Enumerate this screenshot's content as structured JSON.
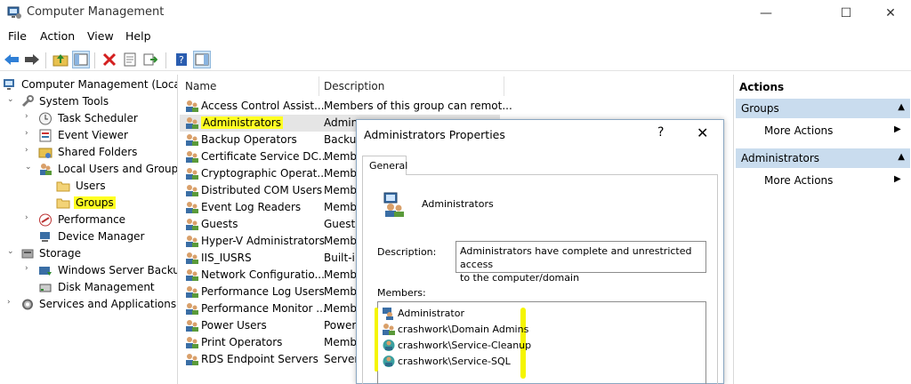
{
  "window": {
    "title": "Computer Management",
    "minimize": "—",
    "maximize": "☐",
    "close": "✕"
  },
  "menu": [
    "File",
    "Action",
    "View",
    "Help"
  ],
  "tree": {
    "root": "Computer Management (Local",
    "system_tools": "System Tools",
    "task_scheduler": "Task Scheduler",
    "event_viewer": "Event Viewer",
    "shared_folders": "Shared Folders",
    "local_users": "Local Users and Groups",
    "users": "Users",
    "groups": "Groups",
    "performance": "Performance",
    "device_manager": "Device Manager",
    "storage": "Storage",
    "wsb": "Windows Server Backup",
    "disk_mgmt": "Disk Management",
    "services": "Services and Applications"
  },
  "list": {
    "col_name": "Name",
    "col_desc": "Description",
    "rows": [
      {
        "name": "Access Control Assist...",
        "desc": "Members of this group can remot..."
      },
      {
        "name": "Administrators",
        "desc": "Admin"
      },
      {
        "name": "Backup Operators",
        "desc": "Backup"
      },
      {
        "name": "Certificate Service DC...",
        "desc": "Memb"
      },
      {
        "name": "Cryptographic Operat...",
        "desc": "Memb"
      },
      {
        "name": "Distributed COM Users",
        "desc": "Memb"
      },
      {
        "name": "Event Log Readers",
        "desc": "Memb"
      },
      {
        "name": "Guests",
        "desc": "Guests"
      },
      {
        "name": "Hyper-V Administrators",
        "desc": "Memb"
      },
      {
        "name": "IIS_IUSRS",
        "desc": "Built-i"
      },
      {
        "name": "Network Configuratio...",
        "desc": "Memb"
      },
      {
        "name": "Performance Log Users",
        "desc": "Memb"
      },
      {
        "name": "Performance Monitor ...",
        "desc": "Memb"
      },
      {
        "name": "Power Users",
        "desc": "Power"
      },
      {
        "name": "Print Operators",
        "desc": "Memb"
      },
      {
        "name": "RDS Endpoint Servers",
        "desc": "Servers"
      }
    ]
  },
  "actions": {
    "header": "Actions",
    "section1": "Groups",
    "section1_item": "More Actions",
    "section2": "Administrators",
    "section2_item": "More Actions"
  },
  "dialog": {
    "title": "Administrators Properties",
    "help": "?",
    "close": "✕",
    "tab": "General",
    "group_name": "Administrators",
    "description_label": "Description:",
    "description_line1": "Administrators have complete and unrestricted access",
    "description_line2": "to the computer/domain",
    "members_label": "Members:",
    "members": [
      "Administrator",
      "crashwork\\Domain Admins",
      "crashwork\\Service-Cleanup",
      "crashwork\\Service-SQL"
    ]
  },
  "colors": {
    "highlight": "#ffff22",
    "actions_section": "#c9dcee",
    "selection": "#e5e5e5"
  }
}
